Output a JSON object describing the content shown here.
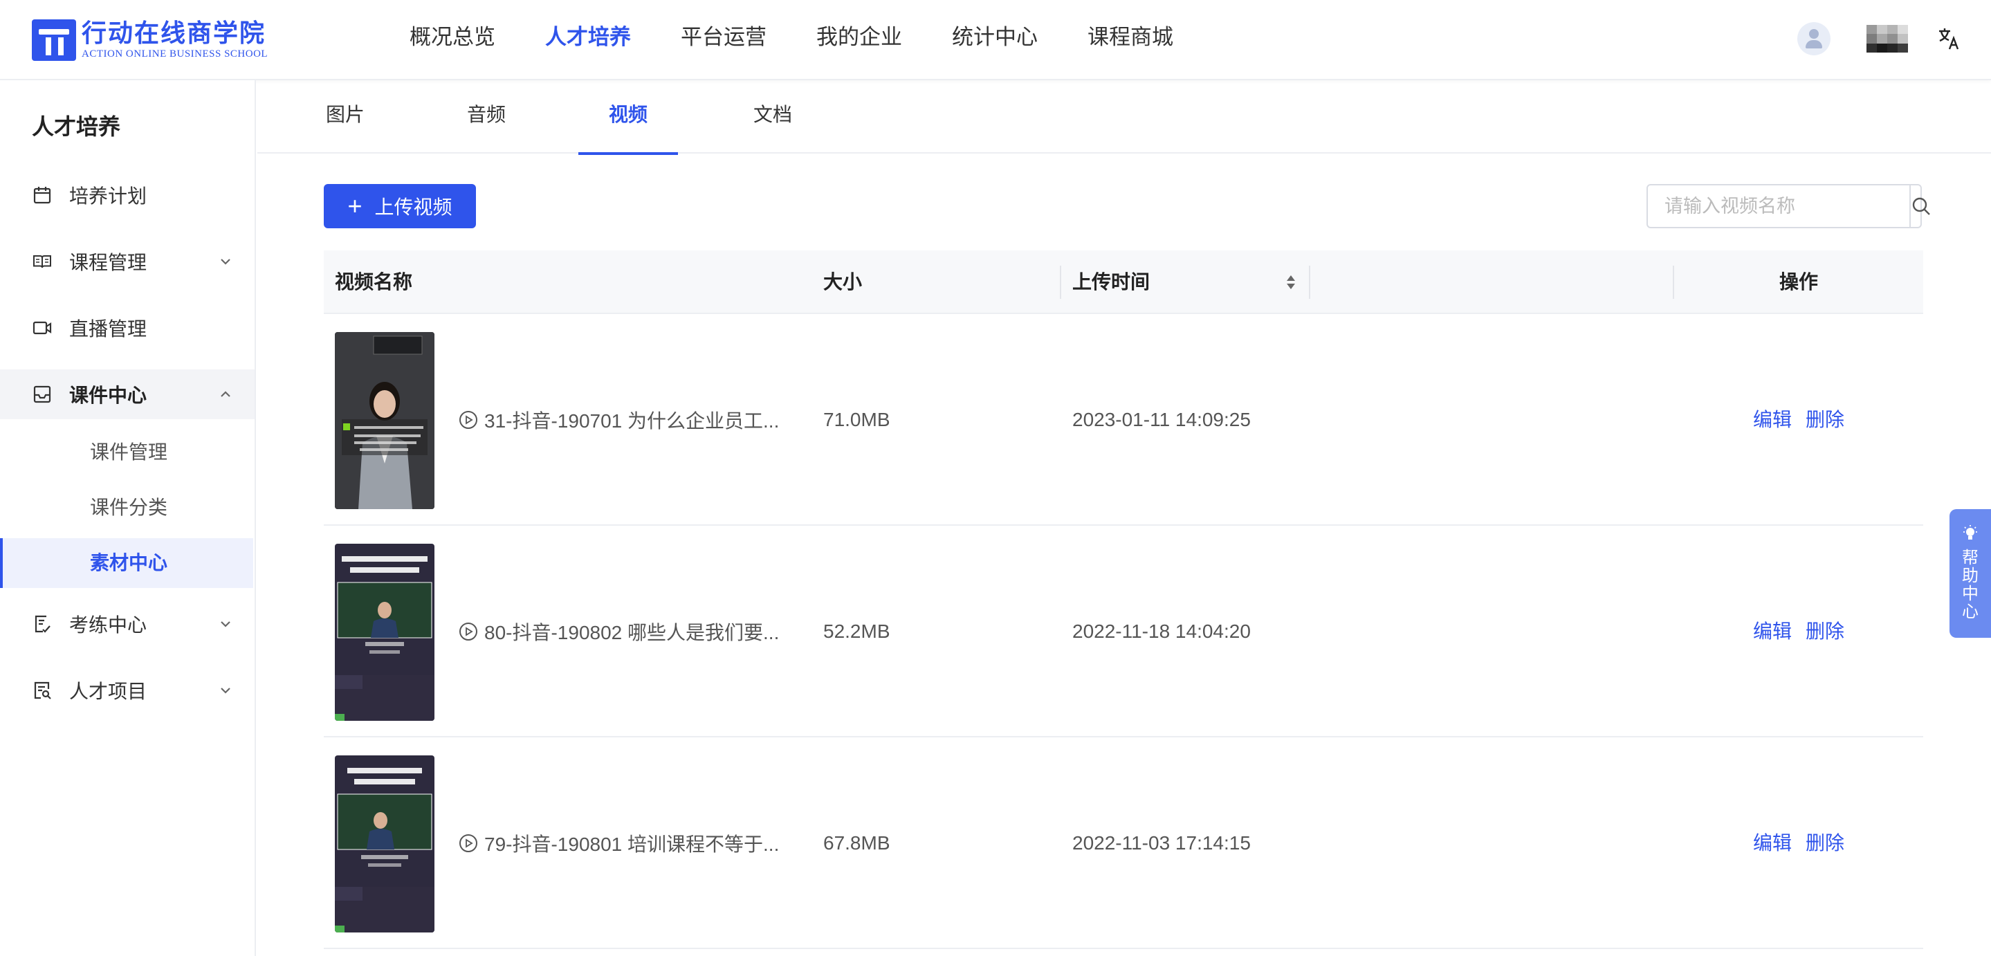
{
  "header": {
    "logo_cn": "行动在线商学院",
    "logo_en": "ACTION ONLINE BUSINESS SCHOOL",
    "nav": [
      {
        "label": "概况总览",
        "active": false
      },
      {
        "label": "人才培养",
        "active": true
      },
      {
        "label": "平台运营",
        "active": false
      },
      {
        "label": "我的企业",
        "active": false
      },
      {
        "label": "统计中心",
        "active": false
      },
      {
        "label": "课程商城",
        "active": false
      }
    ],
    "icons": [
      "avatar-icon",
      "language-icon"
    ]
  },
  "sidebar": {
    "title": "人才培养",
    "items": [
      {
        "label": "培养计划",
        "icon": "calendar-icon"
      },
      {
        "label": "课程管理",
        "icon": "book-icon"
      },
      {
        "label": "直播管理",
        "icon": "video-camera-icon"
      },
      {
        "label": "课件中心",
        "icon": "inbox-icon"
      },
      {
        "label": "考练中心",
        "icon": "exam-icon"
      },
      {
        "label": "人才项目",
        "icon": "project-icon"
      }
    ],
    "sub_items": [
      {
        "label": "课件管理"
      },
      {
        "label": "课件分类"
      },
      {
        "label": "素材中心"
      }
    ]
  },
  "tabs": [
    {
      "label": "图片"
    },
    {
      "label": "音频"
    },
    {
      "label": "视频"
    },
    {
      "label": "文档"
    }
  ],
  "toolbar": {
    "upload_label": "上传视频",
    "search_placeholder": "请输入视频名称"
  },
  "table": {
    "columns": {
      "name": "视频名称",
      "size": "大小",
      "time": "上传时间",
      "actions": "操作"
    },
    "rows": [
      {
        "name": "31-抖音-190701 为什么企业员工...",
        "size": "71.0MB",
        "time": "2023-01-11 14:09:25",
        "edit": "编辑",
        "delete": "删除"
      },
      {
        "name": "80-抖音-190802 哪些人是我们要...",
        "size": "52.2MB",
        "time": "2022-11-18 14:04:20",
        "edit": "编辑",
        "delete": "删除"
      },
      {
        "name": "79-抖音-190801 培训课程不等于...",
        "size": "67.8MB",
        "time": "2022-11-03 17:14:15",
        "edit": "编辑",
        "delete": "删除"
      }
    ]
  },
  "help": {
    "label": "帮助中心"
  },
  "colors": {
    "accent": "#2f54eb",
    "help_bg": "#6b8bf0"
  }
}
